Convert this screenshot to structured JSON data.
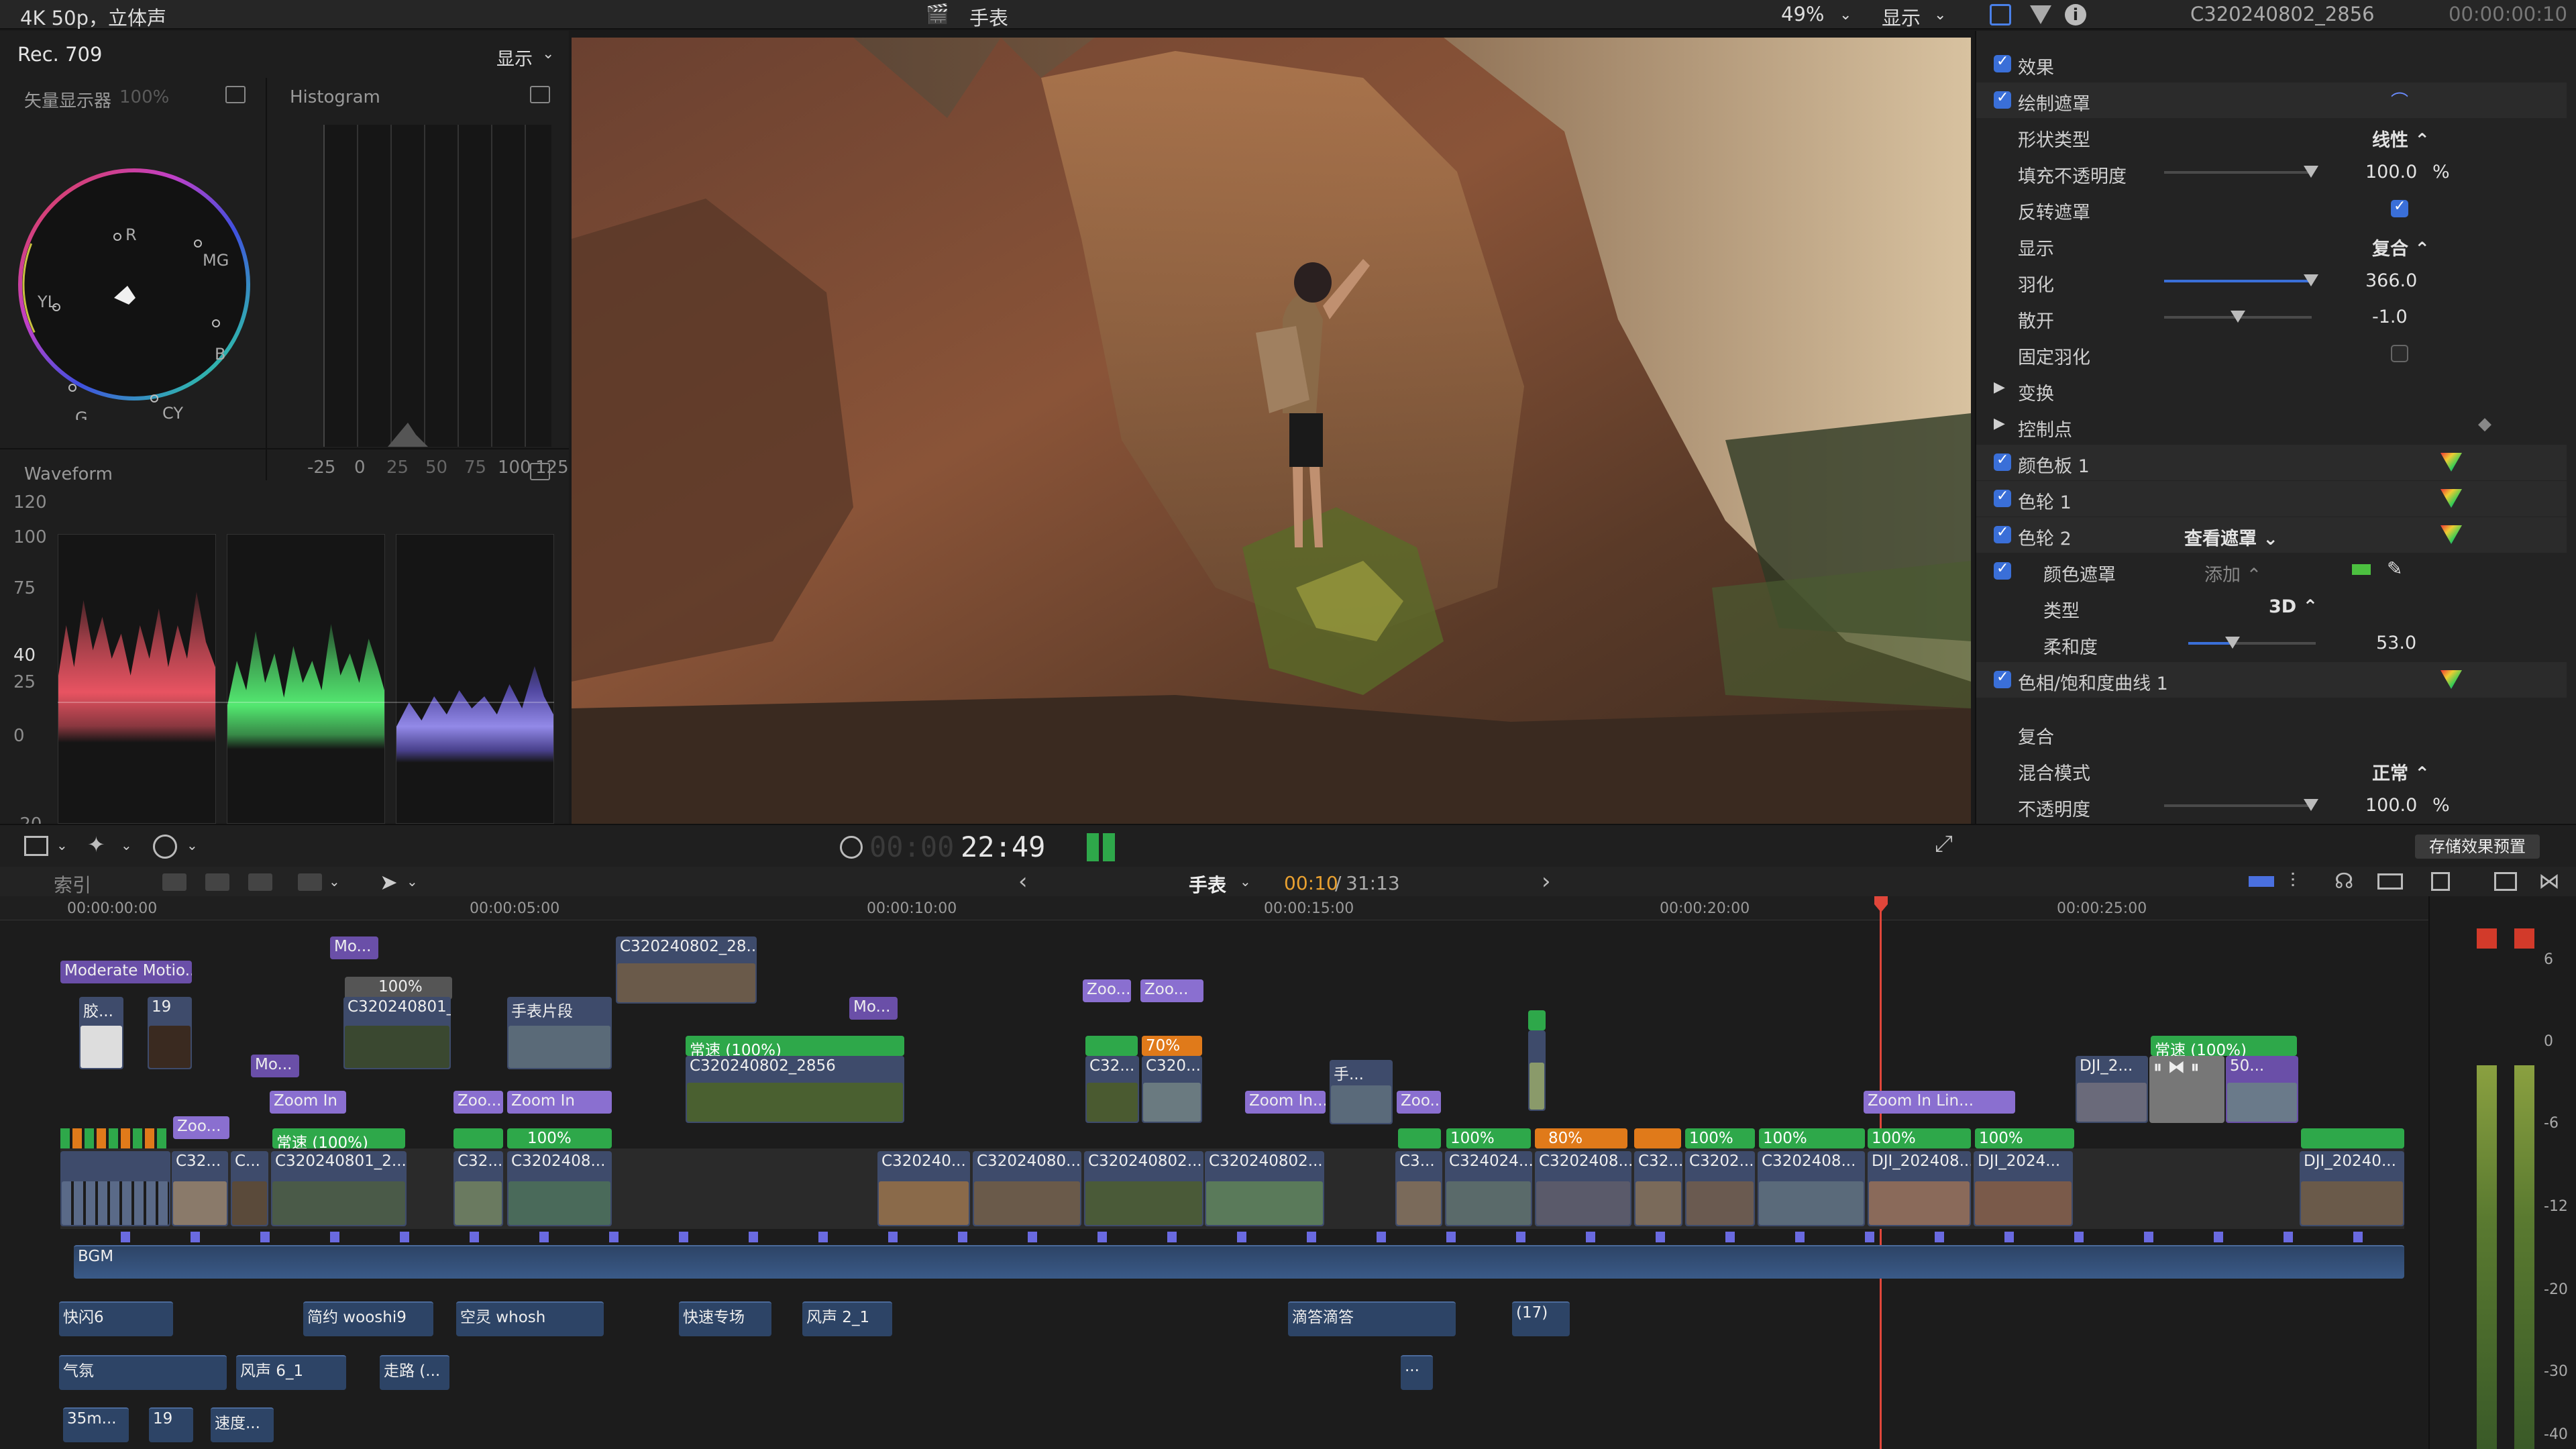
{
  "top": {
    "format": "4K 50p，立体声",
    "project_title": "手表",
    "zoom": "49%",
    "view_menu": "显示",
    "clip_name": "C320240802_2856",
    "clip_time": "00:00:00:10"
  },
  "scopes": {
    "colorspace": "Rec. 709",
    "display_menu": "显示",
    "vectorscope_label": "矢量显示器",
    "vectorscope_pct": "100%",
    "vectorscope_marks": [
      "R",
      "MG",
      "B",
      "CY",
      "G",
      "YL"
    ],
    "histogram_label": "Histogram",
    "histogram_axis": [
      "-25",
      "0",
      "25",
      "50",
      "75",
      "100",
      "125"
    ],
    "waveform_label": "Waveform",
    "waveform_axis": [
      "120",
      "100",
      "75",
      "40",
      "25",
      "0",
      "-20"
    ],
    "channels": [
      "红色",
      "绿色",
      "蓝色"
    ],
    "channel_colors": [
      "#ff5a6a",
      "#5aff7a",
      "#7a6aff"
    ]
  },
  "inspector": {
    "rows": [
      {
        "label": "效果",
        "checkbox": true
      },
      {
        "label": "绘制遮罩",
        "checkbox": true
      },
      {
        "label": "形状类型",
        "value": "线性 ⌃"
      },
      {
        "label": "填充不透明度",
        "value": "100.0",
        "unit": "%",
        "slider": 1.0
      },
      {
        "label": "反转遮罩",
        "check_value": true
      },
      {
        "label": "显示",
        "value": "复合 ⌃"
      },
      {
        "label": "羽化",
        "value": "366.0",
        "slider": 1.0
      },
      {
        "label": "散开",
        "value": "-1.0",
        "slider": 0.5
      },
      {
        "label": "固定羽化",
        "check_value": false
      },
      {
        "label": "变换",
        "disclosure": true
      },
      {
        "label": "控制点",
        "disclosure": true
      },
      {
        "label": "颜色板 1",
        "checkbox": true
      },
      {
        "label": "色轮 1",
        "checkbox": true
      },
      {
        "label": "色轮 2",
        "checkbox": true,
        "value": "查看遮罩 ⌄"
      },
      {
        "label": "颜色遮罩",
        "checkbox": true,
        "value": "添加 ⌃"
      },
      {
        "label": "类型",
        "value": "3D ⌃"
      },
      {
        "label": "柔和度",
        "value": "53.0",
        "slider": 0.35
      },
      {
        "label": "色相/饱和度曲线 1",
        "checkbox": true
      },
      {
        "label": "复合"
      },
      {
        "label": "混合模式",
        "value": "正常 ⌃"
      },
      {
        "label": "不透明度",
        "value": "100.0",
        "unit": "%",
        "slider": 1.0
      }
    ],
    "save_preset": "存储效果预置"
  },
  "transport": {
    "timecode_dim": "00:00",
    "timecode": "22:49"
  },
  "timeline_bar": {
    "index": "索引",
    "project": "手表",
    "position": "00:10",
    "duration": "31:13"
  },
  "ruler": [
    "00:00:00:00",
    "00:00:05:00",
    "00:00:10:00",
    "00:00:15:00",
    "00:00:20:00",
    "00:00:25:00"
  ],
  "clips": {
    "titles": [
      "Moderate Motio...",
      "Mo...",
      "Mo...",
      "Mo...",
      "Zoo...",
      "Zoo...",
      "Zoom In",
      "Zoo...",
      "Zoom In",
      "Zoo...",
      "Zoom In...",
      "Zoo...",
      "Zoom In Lin...",
      "C320240802_28...",
      "手表片段",
      "手...",
      "常速 (100%)",
      "常速 (100%)",
      "70%",
      "100%",
      "80%",
      "100%",
      "100%",
      "100%"
    ],
    "primary": [
      "C32...",
      "C...",
      "C320240801_2...",
      "C32...",
      "C3202408...",
      "C320240...",
      "C32024080...",
      "C320240802...",
      "C320240802...",
      "C3...",
      "C324024...",
      "C3202408...",
      "C32...",
      "C3202...",
      "C3202408...",
      "DJI_202408...",
      "DJI_2024...",
      "DJI_20240...",
      "DJI_202408...",
      "C320240802_2856",
      "C32...",
      "C320...",
      "DJI_2...",
      "50..."
    ],
    "misc": [
      "胶...",
      "19",
      "100%",
      "BGM"
    ]
  },
  "audio_clips": [
    "快闪6",
    "简约 wooshi9",
    "空灵 whosh",
    "快速专场",
    "风声 2_1",
    "滴答滴答",
    "(17)",
    "气氛",
    "风声 6_1",
    "走路 (...",
    "35m...",
    "19",
    "速度...",
    "..."
  ],
  "meter_scale": [
    "6",
    "0",
    "-6",
    "-12",
    "-20",
    "-30",
    "-40"
  ]
}
